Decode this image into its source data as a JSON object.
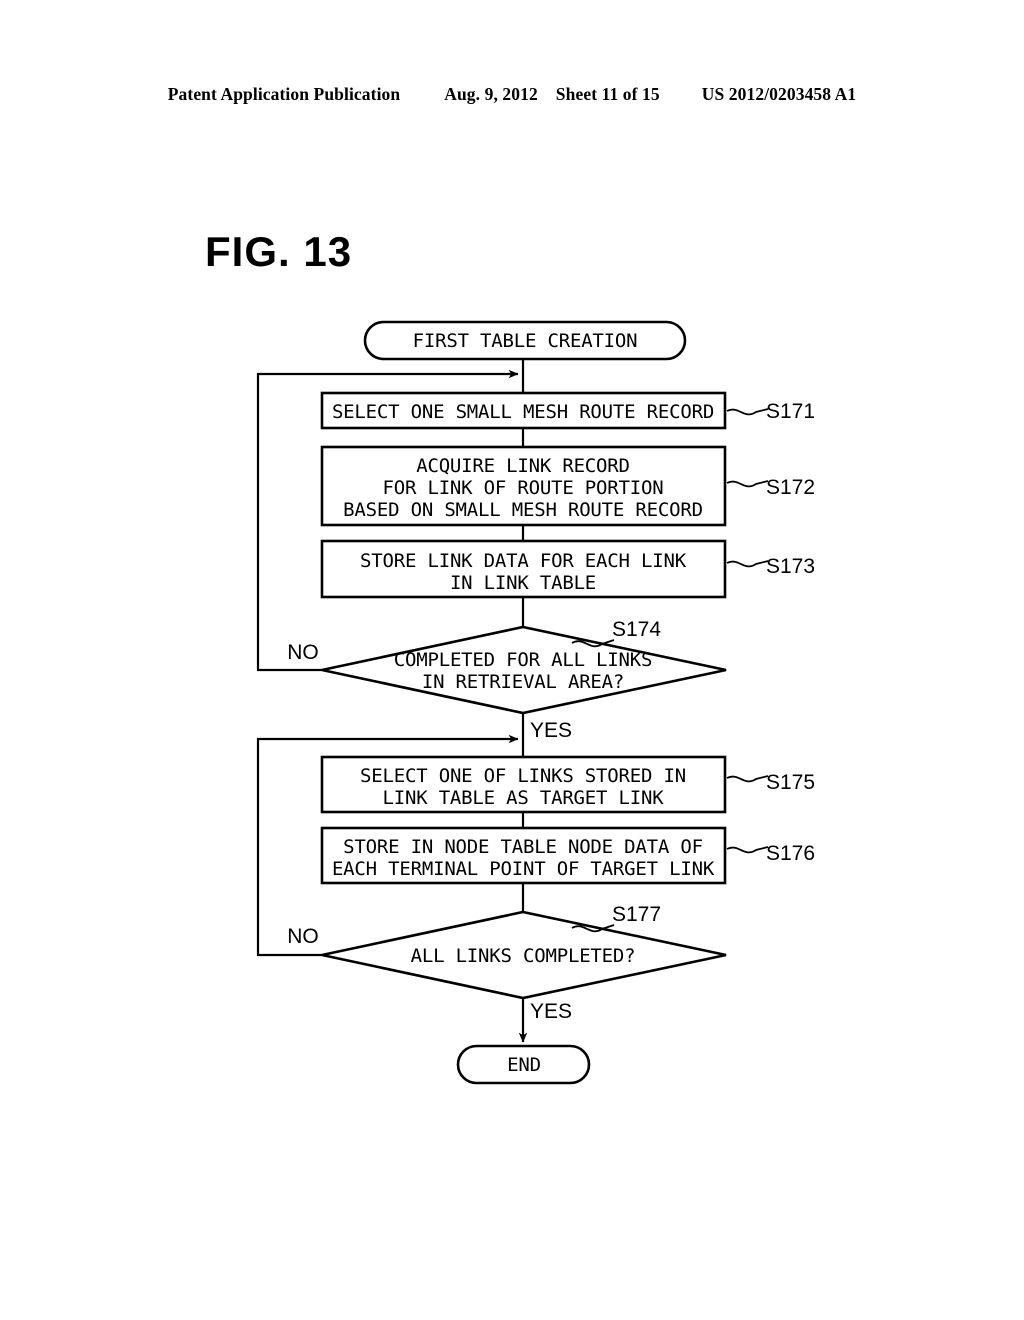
{
  "header": {
    "publication": "Patent Application Publication",
    "date": "Aug. 9, 2012",
    "sheet": "Sheet 11 of 15",
    "patent_number": "US 2012/0203458 A1"
  },
  "figure": {
    "label": "FIG. 13"
  },
  "flowchart": {
    "start": {
      "id": "start-terminal",
      "text": "FIRST TABLE CREATION"
    },
    "end": {
      "id": "end-terminal",
      "text": "END"
    },
    "steps": [
      {
        "id": "s171",
        "step_label": "S171",
        "lines": [
          "SELECT ONE SMALL MESH ROUTE RECORD"
        ]
      },
      {
        "id": "s172",
        "step_label": "S172",
        "lines": [
          "ACQUIRE LINK RECORD",
          "FOR LINK OF ROUTE PORTION",
          "BASED ON SMALL MESH ROUTE RECORD"
        ]
      },
      {
        "id": "s173",
        "step_label": "S173",
        "lines": [
          "STORE LINK DATA FOR EACH LINK",
          "IN LINK TABLE"
        ]
      },
      {
        "id": "s175",
        "step_label": "S175",
        "lines": [
          "SELECT ONE OF LINKS STORED IN",
          "LINK TABLE AS TARGET LINK"
        ]
      },
      {
        "id": "s176",
        "step_label": "S176",
        "lines": [
          "STORE IN NODE TABLE NODE DATA OF",
          "EACH TERMINAL POINT OF TARGET LINK"
        ]
      }
    ],
    "decisions": [
      {
        "id": "s174",
        "step_label": "S174",
        "lines": [
          "COMPLETED FOR ALL LINKS",
          "IN RETRIEVAL AREA?"
        ],
        "no_label": "NO",
        "yes_label": "YES"
      },
      {
        "id": "s177",
        "step_label": "S177",
        "lines": [
          "ALL LINKS COMPLETED?"
        ],
        "no_label": "NO",
        "yes_label": "YES"
      }
    ]
  },
  "colors": {
    "ink": "#000000",
    "paper": "#ffffff"
  }
}
